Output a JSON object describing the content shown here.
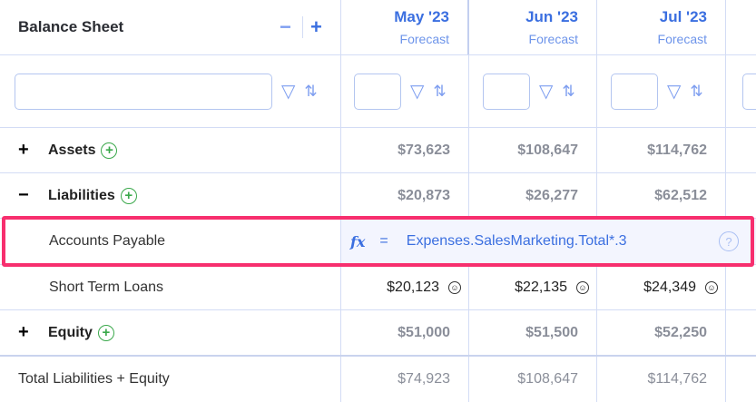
{
  "header": {
    "title": "Balance Sheet",
    "collapse_label": "−",
    "expand_label": "+",
    "columns": [
      {
        "month": "May '23",
        "type": "Forecast"
      },
      {
        "month": "Jun '23",
        "type": "Forecast"
      },
      {
        "month": "Jul '23",
        "type": "Forecast"
      }
    ]
  },
  "filter": {
    "search_value": "",
    "icons": [
      "filter-icon",
      "sort-icon"
    ]
  },
  "rows": [
    {
      "label": "Assets",
      "toggle": "+",
      "values": [
        "$73,623",
        "$108,647",
        "$114,762"
      ]
    },
    {
      "label": "Liabilities",
      "toggle": "−",
      "values": [
        "$20,873",
        "$26,277",
        "$62,512"
      ]
    },
    {
      "label": "Accounts Payable",
      "formula": {
        "fx": "fx",
        "eq": "=",
        "expression": "Expenses.SalesMarketing.Total*.3",
        "help": "?"
      }
    },
    {
      "label": "Short Term Loans",
      "values": [
        "$20,123",
        "$22,135",
        "$24,349"
      ]
    },
    {
      "label": "Equity",
      "toggle": "+",
      "values": [
        "$51,000",
        "$51,500",
        "$52,250"
      ]
    },
    {
      "label": "Total Liabilities + Equity",
      "values": [
        "$74,923",
        "$108,647",
        "$114,762"
      ]
    }
  ],
  "colors": {
    "accent": "#3b6fe0",
    "highlight": "#f72f6e",
    "add": "#3aa84b"
  }
}
